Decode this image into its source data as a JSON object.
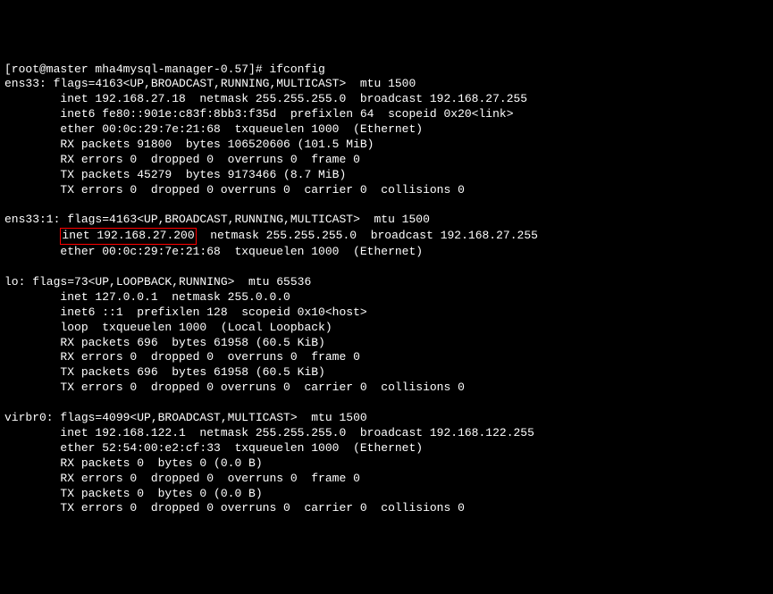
{
  "prompt": "[root@master mha4mysql-manager-0.57]# ifconfig",
  "interfaces": {
    "ens33": {
      "header": "ens33: flags=4163<UP,BROADCAST,RUNNING,MULTICAST>  mtu 1500",
      "inet": "        inet 192.168.27.18  netmask 255.255.255.0  broadcast 192.168.27.255",
      "inet6": "        inet6 fe80::901e:c83f:8bb3:f35d  prefixlen 64  scopeid 0x20<link>",
      "ether": "        ether 00:0c:29:7e:21:68  txqueuelen 1000  (Ethernet)",
      "rx_packets": "        RX packets 91800  bytes 106520606 (101.5 MiB)",
      "rx_errors": "        RX errors 0  dropped 0  overruns 0  frame 0",
      "tx_packets": "        TX packets 45279  bytes 9173466 (8.7 MiB)",
      "tx_errors": "        TX errors 0  dropped 0 overruns 0  carrier 0  collisions 0"
    },
    "ens33_1": {
      "header": "ens33:1: flags=4163<UP,BROADCAST,RUNNING,MULTICAST>  mtu 1500",
      "inet_prefix": "        ",
      "inet_highlight": "inet 192.168.27.200",
      "inet_suffix": "  netmask 255.255.255.0  broadcast 192.168.27.255",
      "ether": "        ether 00:0c:29:7e:21:68  txqueuelen 1000  (Ethernet)"
    },
    "lo": {
      "header": "lo: flags=73<UP,LOOPBACK,RUNNING>  mtu 65536",
      "inet": "        inet 127.0.0.1  netmask 255.0.0.0",
      "inet6": "        inet6 ::1  prefixlen 128  scopeid 0x10<host>",
      "loop": "        loop  txqueuelen 1000  (Local Loopback)",
      "rx_packets": "        RX packets 696  bytes 61958 (60.5 KiB)",
      "rx_errors": "        RX errors 0  dropped 0  overruns 0  frame 0",
      "tx_packets": "        TX packets 696  bytes 61958 (60.5 KiB)",
      "tx_errors": "        TX errors 0  dropped 0 overruns 0  carrier 0  collisions 0"
    },
    "virbr0": {
      "header": "virbr0: flags=4099<UP,BROADCAST,MULTICAST>  mtu 1500",
      "inet": "        inet 192.168.122.1  netmask 255.255.255.0  broadcast 192.168.122.255",
      "ether": "        ether 52:54:00:e2:cf:33  txqueuelen 1000  (Ethernet)",
      "rx_packets": "        RX packets 0  bytes 0 (0.0 B)",
      "rx_errors": "        RX errors 0  dropped 0  overruns 0  frame 0",
      "tx_packets": "        TX packets 0  bytes 0 (0.0 B)",
      "tx_errors": "        TX errors 0  dropped 0 overruns 0  carrier 0  collisions 0"
    }
  }
}
